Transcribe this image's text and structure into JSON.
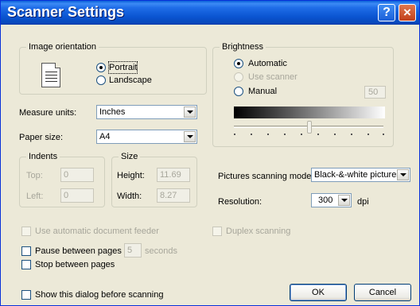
{
  "window": {
    "title": "Scanner Settings",
    "help_glyph": "?",
    "close_glyph": "×"
  },
  "orientation": {
    "group_title": "Image orientation",
    "portrait": "Portrait",
    "landscape": "Landscape",
    "selected": "Portrait"
  },
  "brightness": {
    "group_title": "Brightness",
    "automatic": "Automatic",
    "use_scanner": "Use scanner",
    "manual": "Manual",
    "value": "50",
    "selected": "Automatic",
    "slider_level": 0.5
  },
  "measure_units": {
    "label": "Measure units:",
    "value": "Inches"
  },
  "paper_size": {
    "label": "Paper size:",
    "value": "A4"
  },
  "indents": {
    "group_title": "Indents",
    "top_label": "Top:",
    "top_value": "0",
    "left_label": "Left:",
    "left_value": "0"
  },
  "size": {
    "group_title": "Size",
    "height_label": "Height:",
    "height_value": "11.69",
    "width_label": "Width:",
    "width_value": "8.27"
  },
  "pictures_mode": {
    "label": "Pictures scanning mode:",
    "value": "Black-&-white pictures"
  },
  "resolution": {
    "label": "Resolution:",
    "value": "300",
    "unit": "dpi"
  },
  "options": {
    "auto_feeder": "Use automatic document feeder",
    "duplex": "Duplex scanning",
    "pause": "Pause between pages",
    "pause_seconds": "5",
    "seconds_label": "seconds",
    "stop": "Stop between pages",
    "show_dialog": "Show this dialog before scanning"
  },
  "buttons": {
    "ok": "OK",
    "cancel": "Cancel"
  }
}
